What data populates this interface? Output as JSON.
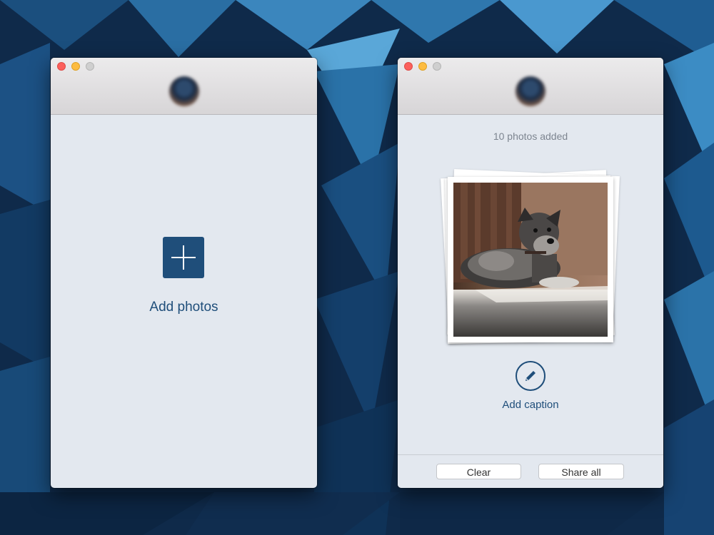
{
  "windows": {
    "left": {
      "add_photos_label": "Add photos"
    },
    "right": {
      "photos_count": "10 photos added",
      "add_caption_label": "Add caption",
      "buttons": {
        "clear": "Clear",
        "share_all": "Share all"
      }
    }
  },
  "colors": {
    "accent": "#1f4e7a",
    "window_bg": "#e3e8ef",
    "close": "#fc605c",
    "minimize": "#fdbc40",
    "zoom_disabled": "#cfcfcf"
  },
  "icons": {
    "add": "plus-icon",
    "caption": "pencil-icon"
  }
}
